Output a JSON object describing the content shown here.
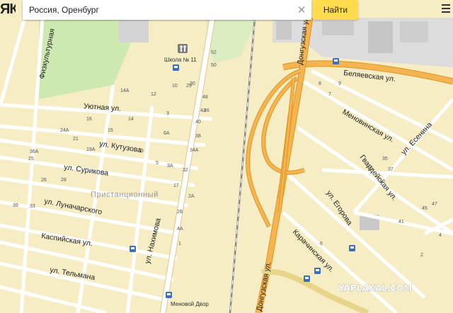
{
  "search": {
    "value": "Россия, Оренбург",
    "find_label": "Найти",
    "clear_icon": "close-icon"
  },
  "logo_text": "ЯК",
  "district": "Пристанционный",
  "streets": {
    "fizkulturnaya": "Физкультурная",
    "uyutnaya": "Уютная ул.",
    "kutuzova": "ул. Кутузова",
    "surikova": "ул. Сурикова",
    "lunacharskogo": "ул. Луначарского",
    "kaspiyskaya": "Каспийская ул.",
    "nakhimova": "ул. Нахимова",
    "telmana": "ул. Тельмана",
    "donguzskaya_top": "Донгузская ул.",
    "donguzskaya_bottom": "Донгузская ул.",
    "belyaevskaya": "Беляевская ул.",
    "menovinskaya": "Меновинская ул.",
    "esenina": "ул. Есенина",
    "gvardeyskaya": "Гвардейская ул.",
    "egorova": "ул. Егорова",
    "karachinskaya": "Карачинская ул."
  },
  "pois": {
    "school": "Школа № 11",
    "menovoy_dvor": "Меновой Двор"
  },
  "watermark": "YAPLAKAL.COM",
  "house_numbers": {
    "n52": "52",
    "n50": "50",
    "n48": "48",
    "n46": "46",
    "n42": "42",
    "n40": "40",
    "n38": "38",
    "n34A": "34А",
    "n32": "32",
    "n30": "30",
    "n29": "29",
    "n10": "10",
    "n14A": "14А",
    "n12": "12",
    "n16": "16",
    "n24A": "24А",
    "n21": "21",
    "n36A": "36А",
    "n19A": "19А",
    "n25": "25",
    "n26": "26",
    "n39": "39",
    "n33": "33",
    "n28": "28",
    "n6A": "6А",
    "n3": "3",
    "n2A": "2А",
    "n2B": "2Б",
    "n4A": "4А",
    "n13": "13",
    "n15": "15",
    "n34A2": "34А",
    "n14": "14",
    "n5": "5",
    "n17": "17",
    "n3A": "3А",
    "n1": "1",
    "n8": "8",
    "n9": "9",
    "n7": "7",
    "n31": "31",
    "n35": "35",
    "n37": "37",
    "n41": "41",
    "n43": "43",
    "n45": "45",
    "n47": "47",
    "n2": "2",
    "n4": "4",
    "n6": "6"
  },
  "colors": {
    "map_bg": "#f6edc4",
    "block_yellow": "#f7ecc0",
    "green": "#cde8b0",
    "industrial": "#dcdcdc",
    "highway": "#f4b452",
    "highway_edge": "#e0951e",
    "road": "#ffffff",
    "road_edge": "#d8c891",
    "rail": "#8a8a8a",
    "search_button": "#ffdb4d"
  }
}
